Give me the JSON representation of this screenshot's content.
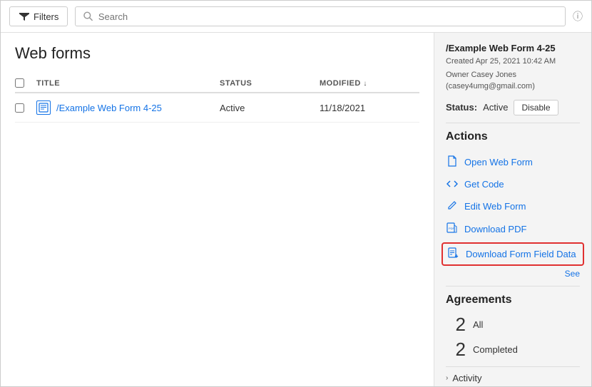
{
  "toolbar": {
    "filter_label": "Filters",
    "search_placeholder": "Search",
    "info_icon": "ⓘ"
  },
  "left_panel": {
    "page_title": "Web forms",
    "table": {
      "headers": {
        "title": "TITLE",
        "status": "STATUS",
        "modified": "MODIFIED"
      },
      "rows": [
        {
          "title": "/Example Web Form 4-25",
          "status": "Active",
          "modified": "11/18/2021"
        }
      ]
    }
  },
  "right_panel": {
    "form_name": "/Example Web Form 4-25",
    "created": "Created Apr 25, 2021 10:42 AM",
    "owner": "Owner Casey Jones (casey4umg@gmail.com)",
    "status_label": "Status:",
    "status_value": "Active",
    "disable_btn": "Disable",
    "actions_title": "Actions",
    "actions": [
      {
        "id": "open-web-form",
        "label": "Open Web Form",
        "icon": "doc"
      },
      {
        "id": "get-code",
        "label": "Get Code",
        "icon": "code"
      },
      {
        "id": "edit-web-form",
        "label": "Edit Web Form",
        "icon": "pencil"
      },
      {
        "id": "download-pdf",
        "label": "Download PDF",
        "icon": "pdf"
      },
      {
        "id": "download-form-field-data",
        "label": "Download Form Field Data",
        "icon": "data",
        "highlighted": true
      }
    ],
    "see_more": "See",
    "agreements_title": "Agreements",
    "agreements": [
      {
        "count": "2",
        "label": "All"
      },
      {
        "count": "2",
        "label": "Completed"
      }
    ],
    "activity_label": "Activity"
  }
}
